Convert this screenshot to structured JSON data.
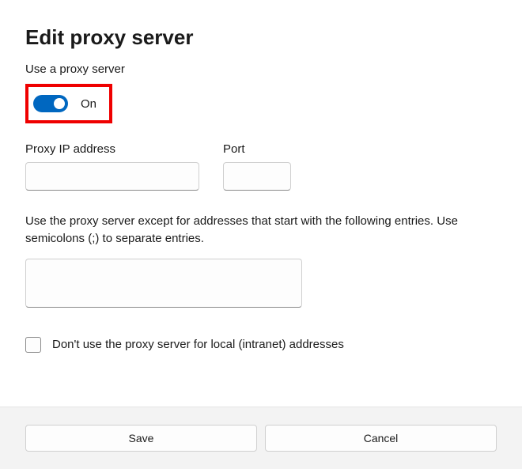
{
  "dialog": {
    "title": "Edit proxy server",
    "use_proxy_label": "Use a proxy server",
    "toggle_state_label": "On",
    "toggle_on": true,
    "ip_label": "Proxy IP address",
    "ip_value": "",
    "port_label": "Port",
    "port_value": "",
    "exceptions_description": "Use the proxy server except for addresses that start with the following entries. Use semicolons (;) to separate entries.",
    "exceptions_value": "",
    "local_bypass_label": "Don't use the proxy server for local (intranet) addresses",
    "local_bypass_checked": false
  },
  "footer": {
    "save_label": "Save",
    "cancel_label": "Cancel"
  },
  "colors": {
    "accent": "#0067c0",
    "highlight_border": "#ef0000"
  }
}
